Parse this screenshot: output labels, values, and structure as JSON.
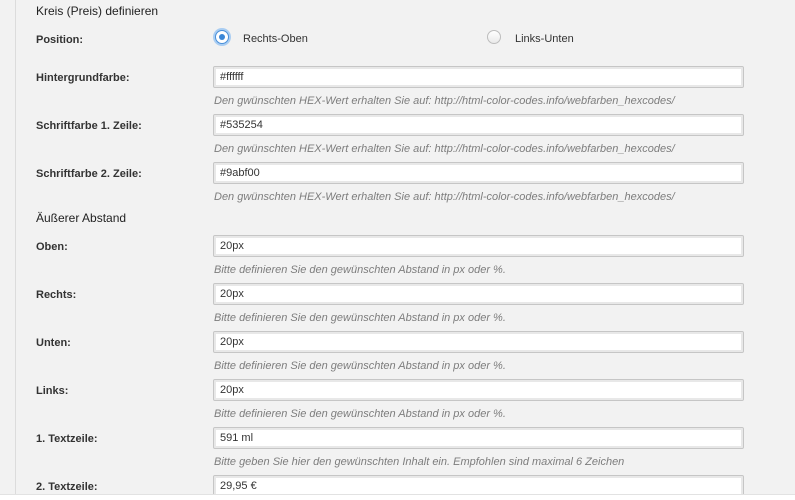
{
  "section_title": "Kreis (Preis) definieren",
  "position": {
    "label": "Position:",
    "options": [
      {
        "label": "Rechts-Oben",
        "checked": true
      },
      {
        "label": "Links-Unten",
        "checked": false
      }
    ]
  },
  "fields_colors": [
    {
      "label": "Hintergrundfarbe:",
      "value": "#ffffff",
      "hint": "Den gwünschten HEX-Wert erhalten Sie auf: http://html-color-codes.info/webfarben_hexcodes/"
    },
    {
      "label": "Schriftfarbe 1. Zeile:",
      "value": "#535254",
      "hint": "Den gwünschten HEX-Wert erhalten Sie auf: http://html-color-codes.info/webfarben_hexcodes/"
    },
    {
      "label": "Schriftfarbe 2. Zeile:",
      "value": "#9abf00",
      "hint": "Den gwünschten HEX-Wert erhalten Sie auf: http://html-color-codes.info/webfarben_hexcodes/"
    }
  ],
  "spacing_title": "Äußerer Abstand",
  "fields_spacing": [
    {
      "label": "Oben:",
      "value": "20px",
      "hint": "Bitte definieren Sie den gewünschten Abstand in px oder %."
    },
    {
      "label": "Rechts:",
      "value": "20px",
      "hint": "Bitte definieren Sie den gewünschten Abstand in px oder %."
    },
    {
      "label": "Unten:",
      "value": "20px",
      "hint": "Bitte definieren Sie den gewünschten Abstand in px oder %."
    },
    {
      "label": "Links:",
      "value": "20px",
      "hint": "Bitte definieren Sie den gewünschten Abstand in px oder %."
    }
  ],
  "fields_text": [
    {
      "label": "1. Textzeile:",
      "value": "591 ml",
      "hint": "Bitte geben Sie hier den gewünschten Inhalt ein. Empfohlen sind maximal 6 Zeichen"
    },
    {
      "label": "2. Textzeile:",
      "value": "29,95 €"
    }
  ]
}
